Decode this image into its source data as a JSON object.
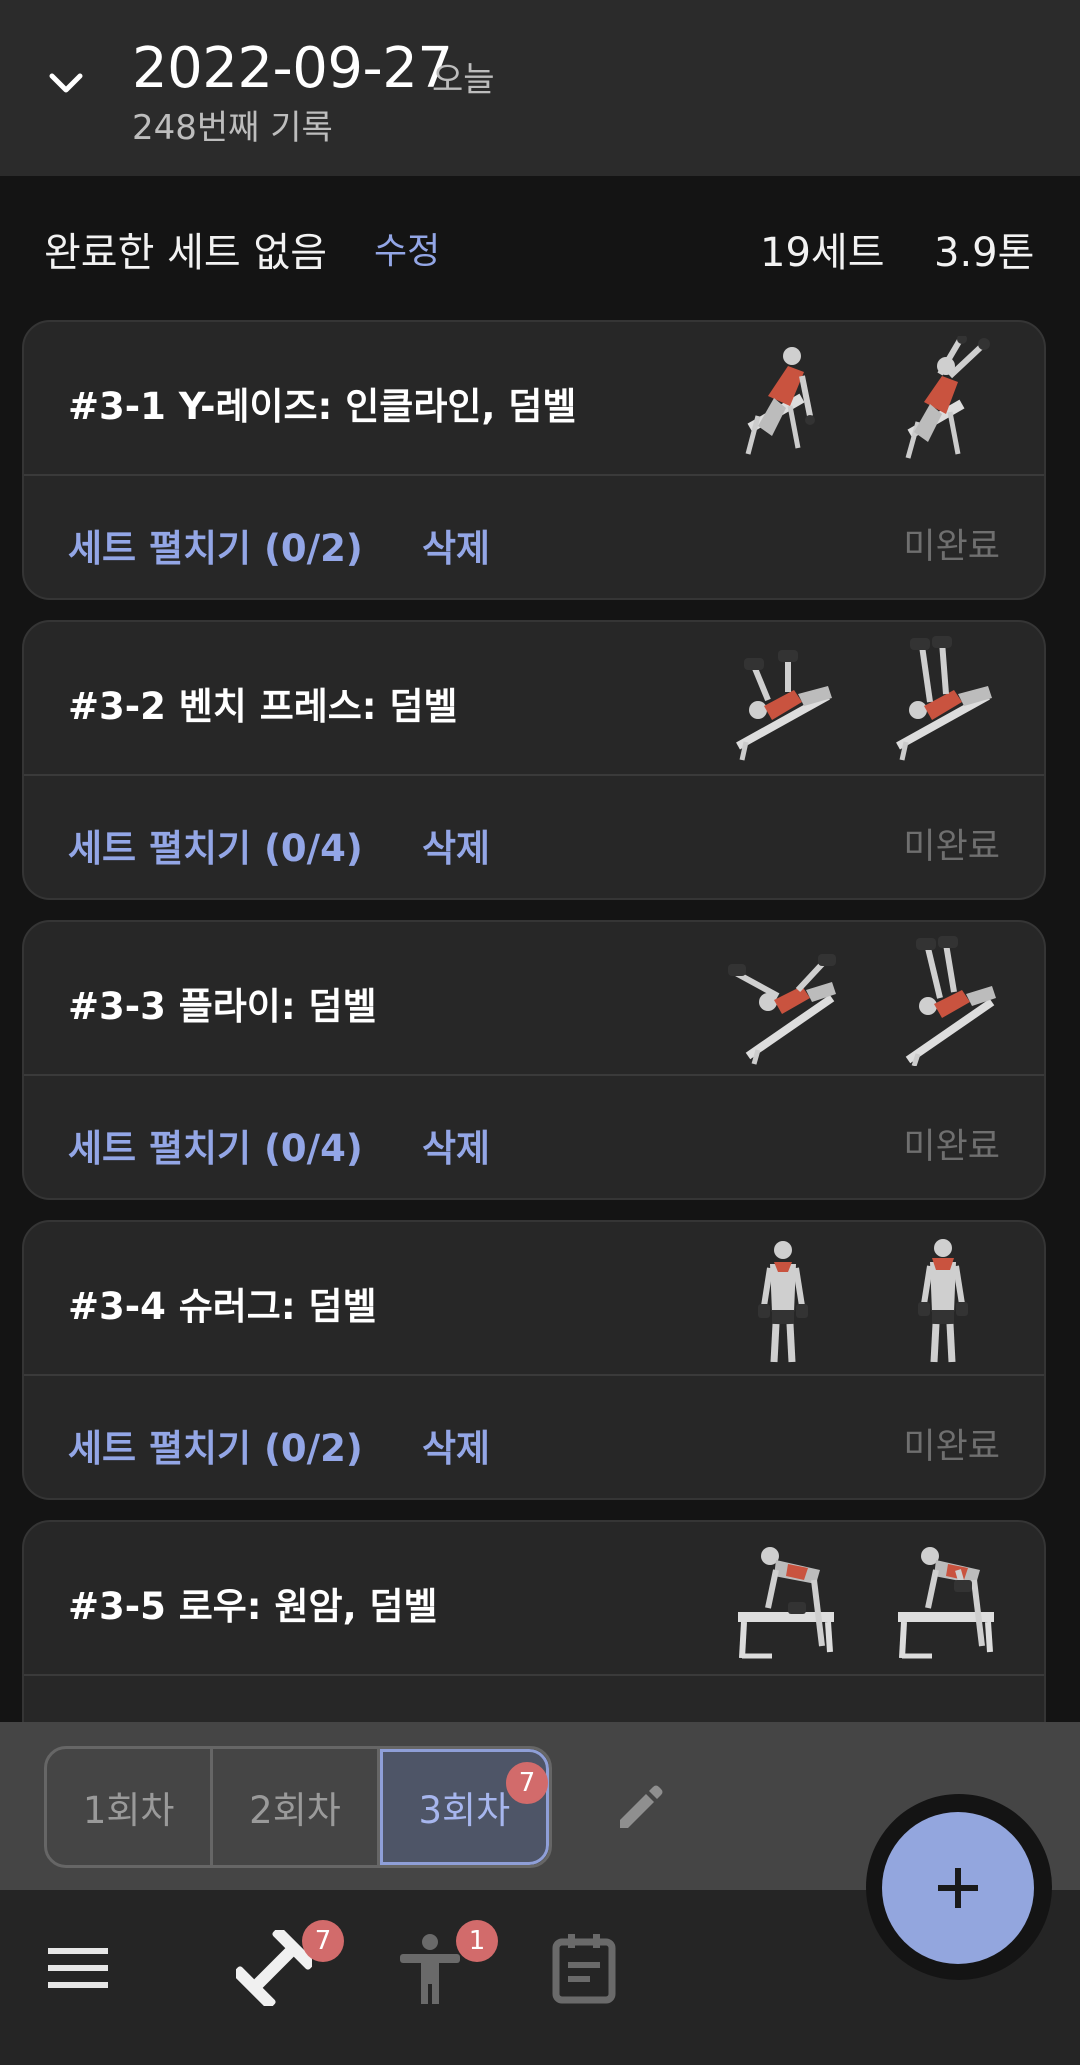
{
  "header": {
    "date": "2022-09-27",
    "today_label": "오늘",
    "record_count": "248번째 기록"
  },
  "summary": {
    "status": "완료한 세트 없음",
    "edit_label": "수정",
    "sets": "19세트",
    "tons": "3.9톤"
  },
  "exercises": [
    {
      "title": "#3-1 Y-레이즈: 인클라인, 덤벨",
      "expand": "세트 펼치기 (0/2)",
      "delete": "삭제",
      "status": "미완료"
    },
    {
      "title": "#3-2 벤치 프레스: 덤벨",
      "expand": "세트 펼치기 (0/4)",
      "delete": "삭제",
      "status": "미완료"
    },
    {
      "title": "#3-3 플라이: 덤벨",
      "expand": "세트 펼치기 (0/4)",
      "delete": "삭제",
      "status": "미완료"
    },
    {
      "title": "#3-4 슈러그: 덤벨",
      "expand": "세트 펼치기 (0/2)",
      "delete": "삭제",
      "status": "미완료"
    },
    {
      "title": "#3-5 로우: 원암, 덤벨",
      "expand": "",
      "delete": "",
      "status": ""
    }
  ],
  "sessions": {
    "tabs": [
      "1회차",
      "2회차",
      "3회차"
    ],
    "active_index": 2,
    "active_badge": "7"
  },
  "bottom_nav": {
    "workout_badge": "7",
    "body_badge": "1"
  },
  "colors": {
    "accent": "#93a6e6",
    "badge": "#d26b6b",
    "card_bg": "#272727",
    "muted": "#6f6f6f"
  }
}
